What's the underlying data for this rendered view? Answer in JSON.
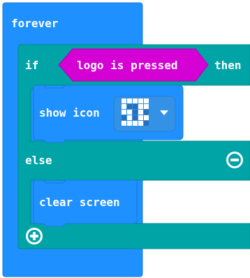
{
  "forever": {
    "label": "forever"
  },
  "if_block": {
    "if_label": "if",
    "then_label": "then",
    "else_label": "else",
    "condition": "logo is pressed"
  },
  "show_icon": {
    "label": "show icon"
  },
  "clear_screen": {
    "label": "clear screen"
  },
  "colors": {
    "forever": "#1e90ff",
    "if": "#00a4a6",
    "if_dark": "#008c8e",
    "condition": "#d400d4",
    "basic": "#1e90ff",
    "icon_bg": "#3391e6"
  },
  "icons": {
    "remove_else": "minus-circle-icon",
    "add_branch": "plus-circle-icon",
    "dropdown": "chevron-down-icon"
  }
}
